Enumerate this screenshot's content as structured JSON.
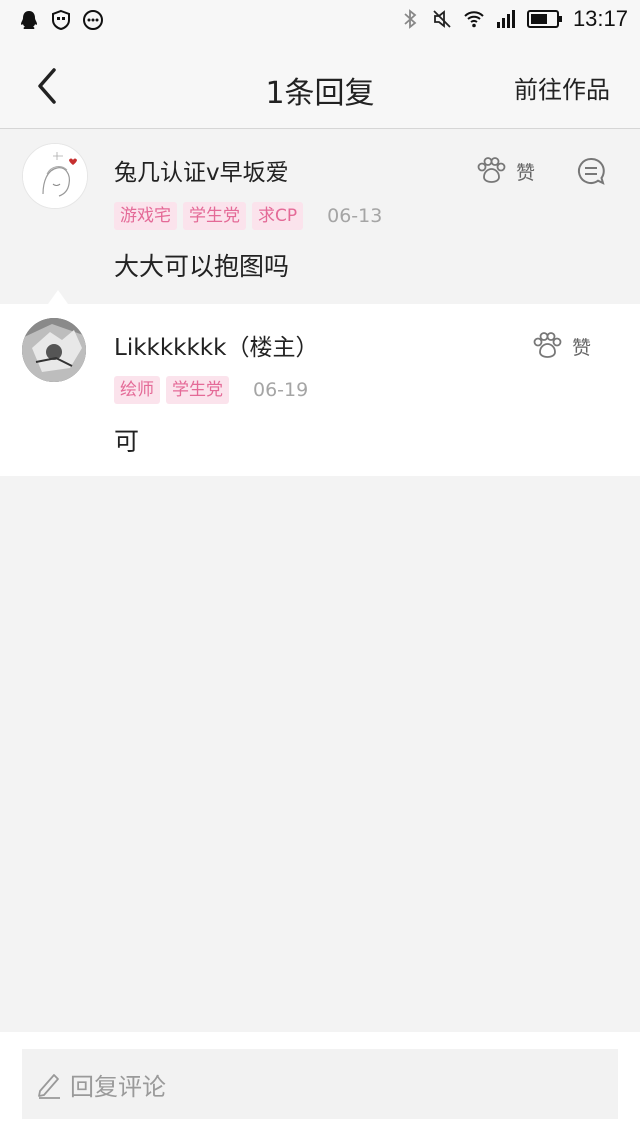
{
  "status_bar": {
    "time": "13:17",
    "left_icons": [
      "qq-icon",
      "shield-icon",
      "message-bubble-icon"
    ],
    "right_icons": [
      "bluetooth-icon",
      "mute-icon",
      "wifi-icon",
      "signal-icon",
      "battery-icon"
    ]
  },
  "header": {
    "title": "1条回复",
    "action": "前往作品"
  },
  "parent_comment": {
    "username": "兔几认证v早坂爱",
    "tags": [
      "游戏宅",
      "学生党",
      "求CP"
    ],
    "date": "06-13",
    "content": "大大可以抱图吗",
    "like_label": "赞"
  },
  "reply_comment": {
    "username": "Likkkkkkk（楼主）",
    "tags": [
      "绘师",
      "学生党"
    ],
    "date": "06-19",
    "content": "可",
    "like_label": "赞"
  },
  "bottom_bar": {
    "placeholder": "回复评论"
  },
  "colors": {
    "tag_bg": "#fbe3ec",
    "tag_text": "#e46a97",
    "background": "#f3f3f3"
  }
}
